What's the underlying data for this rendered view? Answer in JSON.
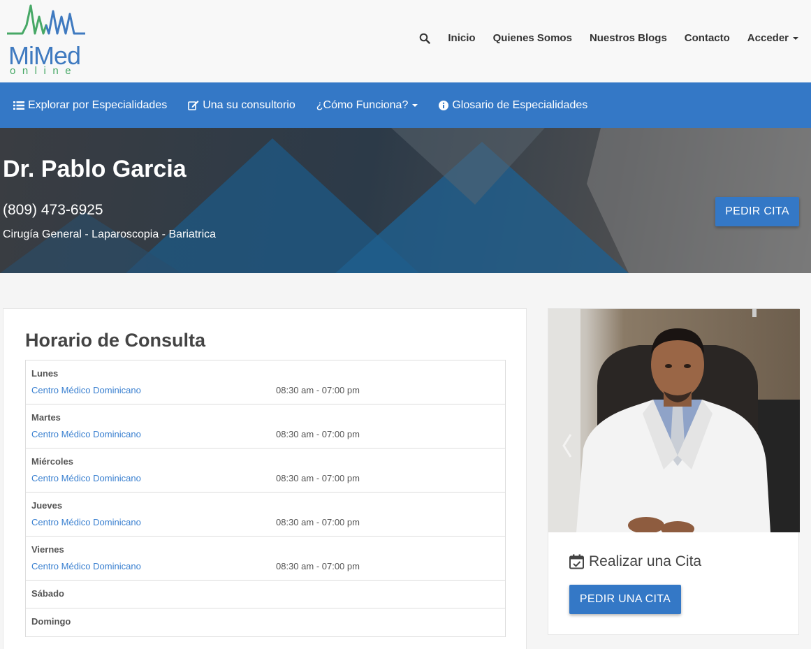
{
  "brand": {
    "name": "MiMed",
    "tagline": "online"
  },
  "topnav": {
    "items": [
      "Inicio",
      "Quienes Somos",
      "Nuestros Blogs",
      "Contacto"
    ],
    "account": "Acceder"
  },
  "bluenav": {
    "explore": "Explorar por Especialidades",
    "join": "Una su consultorio",
    "how": "¿Cómo Funciona?",
    "glossary": "Glosario de Especialidades"
  },
  "doctor": {
    "name": "Dr. Pablo Garcia",
    "phone": "(809) 473-6925",
    "specialties": "Cirugía General - Laparoscopia - Bariatrica",
    "cta": "PEDIR CITA"
  },
  "schedule": {
    "title": "Horario de Consulta",
    "rows": [
      {
        "day": "Lunes",
        "location": "Centro Médico Dominicano",
        "time": "08:30 am - 07:00 pm"
      },
      {
        "day": "Martes",
        "location": "Centro Médico Dominicano",
        "time": "08:30 am - 07:00 pm"
      },
      {
        "day": "Miércoles",
        "location": "Centro Médico Dominicano",
        "time": "08:30 am - 07:00 pm"
      },
      {
        "day": "Jueves",
        "location": "Centro Médico Dominicano",
        "time": "08:30 am - 07:00 pm"
      },
      {
        "day": "Viernes",
        "location": "Centro Médico Dominicano",
        "time": "08:30 am - 07:00 pm"
      },
      {
        "day": "Sábado"
      },
      {
        "day": "Domingo"
      }
    ]
  },
  "appointment": {
    "title": "Realizar una Cita",
    "button": "PEDIR UNA CITA"
  },
  "colors": {
    "primary": "#3478c6",
    "link": "#3a80d0",
    "logo_blue": "#3f7ac0",
    "logo_green": "#47a866"
  }
}
